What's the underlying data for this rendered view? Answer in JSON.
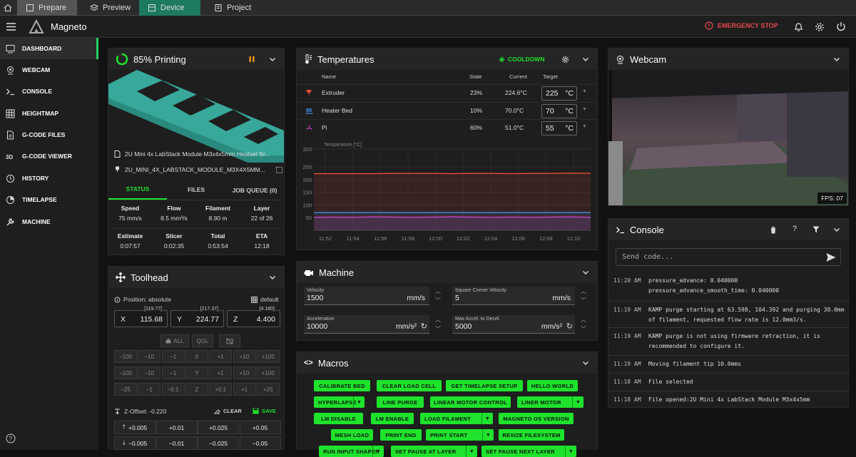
{
  "topbar": {
    "tabs": [
      "Prepare",
      "Preview",
      "Device",
      "Project"
    ]
  },
  "app": {
    "name": "Magneto",
    "emergency": "EMERGENCY STOP"
  },
  "sidebar": {
    "items": [
      "Dashboard",
      "Webcam",
      "Console",
      "Heightmap",
      "G-Code Files",
      "G-Code Viewer",
      "History",
      "Timelapse",
      "Machine"
    ]
  },
  "status": {
    "title": "85% Printing",
    "progress": 0.85,
    "file1": "2U Mini 4x LabStack Module M3x4x5mm Heatset Br...",
    "file2": "2U_MINI_4X_LABSTACK_MODULE_M3X4X5MM...",
    "tabs": [
      "STATUS",
      "FILES",
      "JOB QUEUE (0)"
    ],
    "stats1": [
      {
        "k": "Speed",
        "v": "75 mm/s"
      },
      {
        "k": "Flow",
        "v": "8.5 mm³/s"
      },
      {
        "k": "Filament",
        "v": "8.90 m"
      },
      {
        "k": "Layer",
        "v": "22 of 26"
      }
    ],
    "stats2": [
      {
        "k": "Estimate",
        "v": "0:07:57"
      },
      {
        "k": "Slicer",
        "v": "0:02:35"
      },
      {
        "k": "Total",
        "v": "0:53:54"
      },
      {
        "k": "ETA",
        "v": "12:18"
      }
    ]
  },
  "toolhead": {
    "title": "Toolhead",
    "position": "Position: absolute",
    "default": "default",
    "axes": [
      {
        "a": "X",
        "v": "115.68",
        "b": "[119.77]"
      },
      {
        "a": "Y",
        "v": "224.77",
        "b": "[217.37]"
      },
      {
        "a": "Z",
        "v": "4.400",
        "b": "[4.180]"
      }
    ],
    "home": [
      "ALL",
      "QGL"
    ],
    "row1": [
      "−100",
      "−10",
      "−1",
      "X",
      "+1",
      "+10",
      "+100"
    ],
    "row2": [
      "−100",
      "−10",
      "−1",
      "Y",
      "+1",
      "+10",
      "+100"
    ],
    "row3": [
      "−25",
      "−1",
      "−0.1",
      "Z",
      "+0.1",
      "+1",
      "+25"
    ],
    "zoffset": "Z-Offset: -0.220",
    "clear": "CLEAR",
    "save": "SAVE",
    "zup": [
      "+0.005",
      "+0.01",
      "+0.025",
      "+0.05"
    ],
    "zdown": [
      "−0.005",
      "−0.01",
      "−0.025",
      "−0.05"
    ]
  },
  "temps": {
    "title": "Temperatures",
    "cooldown": "COOLDOWN",
    "headers": [
      "Name",
      "State",
      "Current",
      "Target"
    ],
    "rows": [
      {
        "name": "Extruder",
        "state": "23%",
        "current": "224.6°C",
        "target": "225",
        "unit": "°C",
        "color": "#e74c3c"
      },
      {
        "name": "Heater Bed",
        "state": "10%",
        "current": "70.0°C",
        "target": "70",
        "unit": "°C",
        "color": "#3a8ee6"
      },
      {
        "name": "Pi",
        "state": "60%",
        "current": "51.0°C",
        "target": "55",
        "unit": "°C",
        "color": "#c040c0"
      }
    ]
  },
  "chart_data": {
    "type": "line",
    "ylabel": "Temperature [°C]",
    "ylim": [
      0,
      320
    ],
    "yticks": [
      50,
      100,
      150,
      200,
      250,
      320
    ],
    "xticks": [
      "11:52",
      "11:54",
      "11:56",
      "11:58",
      "12:00",
      "12:02",
      "12:04",
      "12:06",
      "12:08",
      "12:10"
    ],
    "series": [
      {
        "name": "Extruder",
        "color": "#e74c3c",
        "values": [
          223,
          223,
          223,
          223,
          224,
          224,
          224,
          223,
          224,
          224,
          223,
          224,
          224,
          225,
          224
        ]
      },
      {
        "name": "Heater Bed",
        "color": "#3a8ee6",
        "values": [
          70,
          70,
          70,
          70,
          70,
          70,
          70,
          70,
          70,
          70,
          70,
          70,
          70,
          70,
          70
        ]
      },
      {
        "name": "Pi",
        "color": "#c040c0",
        "values": [
          51,
          52,
          51,
          53,
          52,
          51,
          52,
          53,
          52,
          51,
          52,
          51,
          52,
          53,
          51
        ]
      }
    ]
  },
  "machine": {
    "title": "Machine",
    "fields": [
      {
        "l": "Velocity",
        "v": "1500",
        "u": "mm/s"
      },
      {
        "l": "Square Corner Velocity",
        "v": "5",
        "u": "mm/s"
      },
      {
        "l": "Acceleration",
        "v": "10000",
        "u": "mm/s²"
      },
      {
        "l": "Max Accel. to Decel.",
        "v": "5000",
        "u": "mm/s²"
      }
    ]
  },
  "macros": {
    "title": "Macros",
    "buttons": [
      "CALIBRATE BED",
      "CLEAR LOAD CELL",
      "GET TIMELAPSE SETUP",
      "HELLO WORLD",
      "HYPERLAPSE",
      "LINE PURGE",
      "LINEAR MOTOR CONTROL",
      "LINER MOTOR",
      "LM DISABLE",
      "LM ENABLE",
      "LOAD FILAMENT",
      "MAGNETO OS VERSION",
      "MESH LOAD",
      "PRINT END",
      "PRINT START",
      "RESIZE FILESYSTEM",
      "RUN INPUT SHAPER",
      "SET PAUSE AT LAYER",
      "SET PAUSE NEXT LAYER"
    ]
  },
  "webcam": {
    "title": "Webcam",
    "fps": "FPS: 07"
  },
  "console": {
    "title": "Console",
    "placeholder": "Send code...",
    "lines": [
      {
        "t": "11:20 AM",
        "m": "pressure_advance: 0.040000\npressure_advance_smooth_time: 0.040000"
      },
      {
        "t": "11:19 AM",
        "m": "KAMP purge starting at 63.598, 104.392 and purging 30.0mm of filament, requested flow rate is 12.0mm3/s."
      },
      {
        "t": "11:19 AM",
        "m": "KAMP purge is not using firmware retraction, it is recommended to configure it."
      },
      {
        "t": "11:19 AM",
        "m": "Moving filament tip 10.0mms"
      },
      {
        "t": "11:18 AM",
        "m": "File selected"
      },
      {
        "t": "11:18 AM",
        "m": "File opened:2U Mini 4x LabStack Module M3x4x5mm"
      }
    ]
  }
}
